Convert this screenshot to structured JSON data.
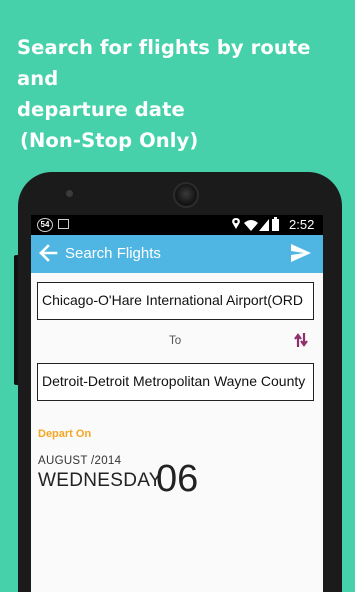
{
  "promo": {
    "line1": "Search for flights by route and",
    "line2": "departure date",
    "line3": "(Non-Stop Only)"
  },
  "status_bar": {
    "notification_badge": "54",
    "time": "2:52",
    "icons": [
      "notification-badge-icon",
      "image-icon",
      "location-icon",
      "wifi-icon",
      "signal-icon",
      "battery-icon"
    ]
  },
  "app_bar": {
    "title": "Search Flights",
    "color": "#4fb6e3",
    "back_icon": "back-arrow-icon",
    "action_icon": "send-icon"
  },
  "form": {
    "from_value": "Chicago-O'Hare International Airport(ORD",
    "to_label": "To",
    "to_value": "Detroit-Detroit Metropolitan Wayne County",
    "swap_icon": "swap-icon",
    "depart_label": "Depart On",
    "depart_label_color": "#f5a623",
    "month_year": "AUGUST /2014",
    "weekday": "WEDNESDAY",
    "day": "06"
  },
  "colors": {
    "background": "#47d1ab",
    "swap_icon": "#8e2f6b"
  }
}
